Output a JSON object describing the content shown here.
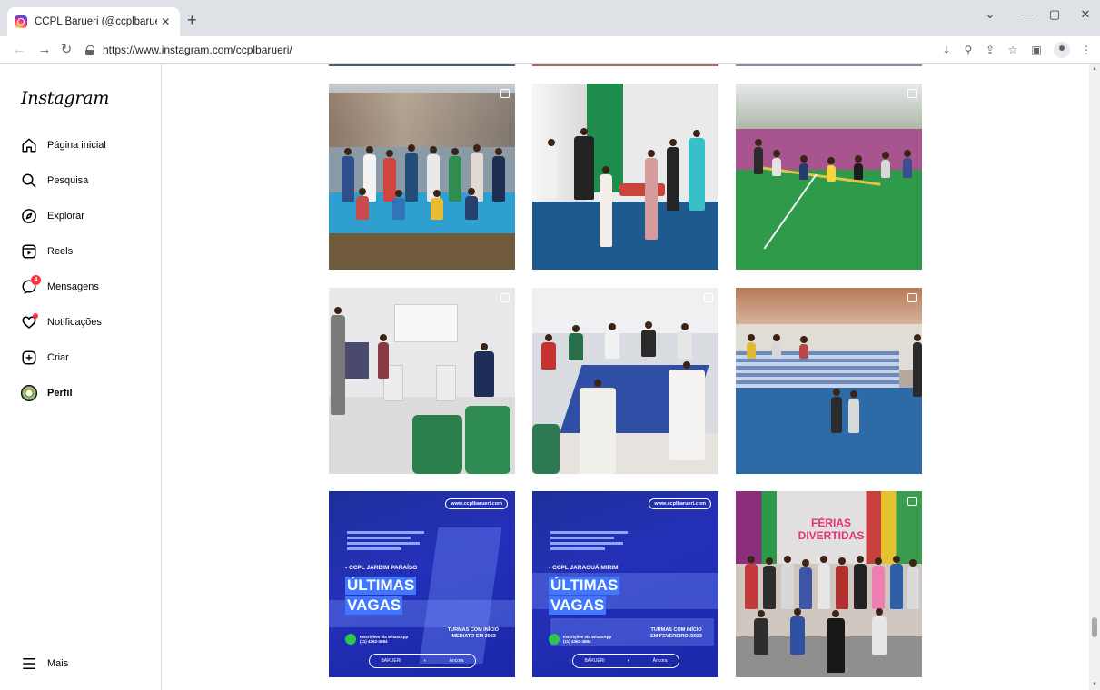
{
  "browser": {
    "tab_title": "CCPL Barueri (@ccplbarueri) • Fo",
    "url": "https://www.instagram.com/ccplbarueri/"
  },
  "icons": {
    "back": "arrow-left-icon",
    "forward": "arrow-right-icon",
    "reload": "reload-icon",
    "lock": "lock-icon",
    "install": "install-app-icon",
    "zoom": "zoom-icon",
    "share": "share-icon",
    "bookmark": "star-icon",
    "side_panel": "side-panel-icon",
    "profile": "profile-icon",
    "menu": "kebab-menu-icon"
  },
  "instagram": {
    "logo": "Instagram",
    "nav": [
      {
        "label": "Página inicial",
        "icon": "home-icon"
      },
      {
        "label": "Pesquisa",
        "icon": "search-icon"
      },
      {
        "label": "Explorar",
        "icon": "compass-icon"
      },
      {
        "label": "Reels",
        "icon": "reels-icon"
      },
      {
        "label": "Mensagens",
        "icon": "messenger-icon",
        "badge": "4"
      },
      {
        "label": "Notificações",
        "icon": "heart-icon"
      },
      {
        "label": "Criar",
        "icon": "create-plus-icon"
      },
      {
        "label": "Perfil",
        "icon": "avatar"
      }
    ],
    "more": "Mais"
  },
  "promos": [
    {
      "site": "www.ccplbarueri.com",
      "unit": "• CCPL JARDIM PARAÍSO",
      "line1": "ÚLTIMAS",
      "line2": "VAGAS",
      "whatsapp_1": "Inscrições via WhatsApp",
      "whatsapp_2": "(11) 4362-4684",
      "turmas_1": "TURMAS COM INÍCIO",
      "turmas_2": "IMEDIATO EM 2023",
      "footer_1": "BARUERI",
      "footer_2": "Âncora"
    },
    {
      "site": "www.ccplbarueri.com",
      "unit": "• CCPL JARAGUÁ MIRIM",
      "line1": "ÚLTIMAS",
      "line2": "VAGAS",
      "whatsapp_1": "Inscrições via WhatsApp",
      "whatsapp_2": "(11) 4362-4684",
      "turmas_1": "TURMAS COM INÍCIO",
      "turmas_2": "EM FEVEREIRO /2023",
      "footer_1": "BARUERI",
      "footer_2": "Âncora"
    }
  ],
  "ferias_banner": "FÉRIAS DIVERTIDAS",
  "colors": {
    "promo_blue": "#2430b8",
    "badge_red": "#ff3040",
    "sidebar_border": "#dbdbdb"
  }
}
